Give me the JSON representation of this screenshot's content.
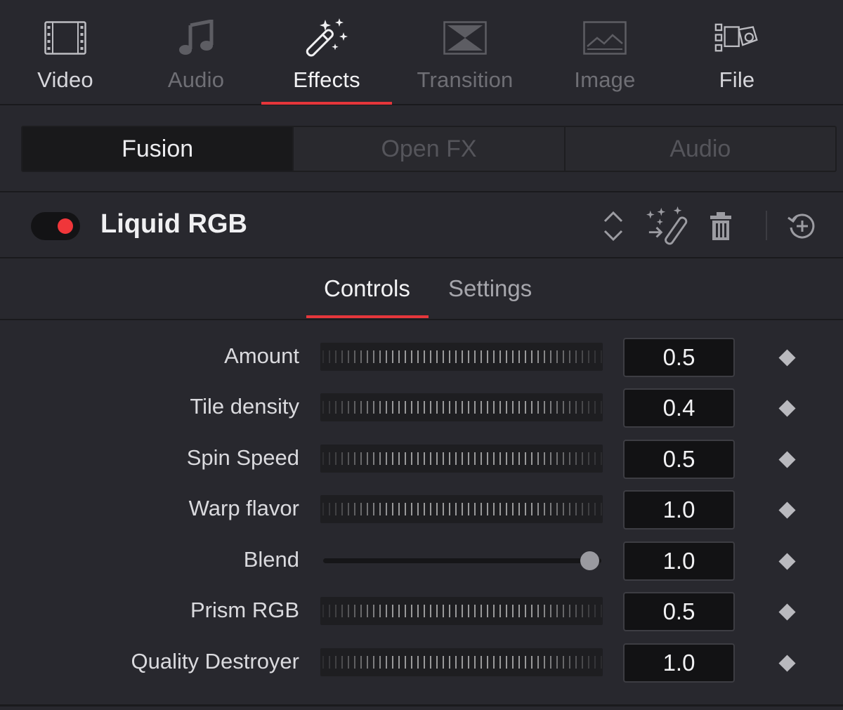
{
  "top_tabs": [
    {
      "label": "Video",
      "icon": "film-strip-icon",
      "state": "enabled"
    },
    {
      "label": "Audio",
      "icon": "music-note-icon",
      "state": "disabled"
    },
    {
      "label": "Effects",
      "icon": "magic-wand-icon",
      "state": "active"
    },
    {
      "label": "Transition",
      "icon": "transition-icon",
      "state": "disabled"
    },
    {
      "label": "Image",
      "icon": "image-icon",
      "state": "disabled"
    },
    {
      "label": "File",
      "icon": "file-camera-icon",
      "state": "enabled"
    }
  ],
  "categories": [
    {
      "label": "Fusion",
      "active": true
    },
    {
      "label": "Open FX",
      "active": false
    },
    {
      "label": "Audio",
      "active": false
    }
  ],
  "effect": {
    "name": "Liquid RGB",
    "enabled": true,
    "toggle_color": "#f0363a",
    "actions": [
      "expand-collapse-icon",
      "apply-effect-icon",
      "trash-icon",
      "reset-icon"
    ]
  },
  "sub_tabs": [
    {
      "label": "Controls",
      "active": true
    },
    {
      "label": "Settings",
      "active": false
    }
  ],
  "controls": [
    {
      "label": "Amount",
      "type": "ruler",
      "value": "0.5"
    },
    {
      "label": "Tile density",
      "type": "ruler",
      "value": "0.4"
    },
    {
      "label": "Spin Speed",
      "type": "ruler",
      "value": "0.5"
    },
    {
      "label": "Warp flavor",
      "type": "ruler",
      "value": "1.0"
    },
    {
      "label": "Blend",
      "type": "slider",
      "value": "1.0",
      "slider_fraction": 0.96
    },
    {
      "label": "Prism RGB",
      "type": "ruler",
      "value": "0.5"
    },
    {
      "label": "Quality Destroyer",
      "type": "ruler",
      "value": "1.0"
    }
  ],
  "colors": {
    "accent": "#e5363b",
    "background": "#28282e",
    "field": "#121214"
  }
}
